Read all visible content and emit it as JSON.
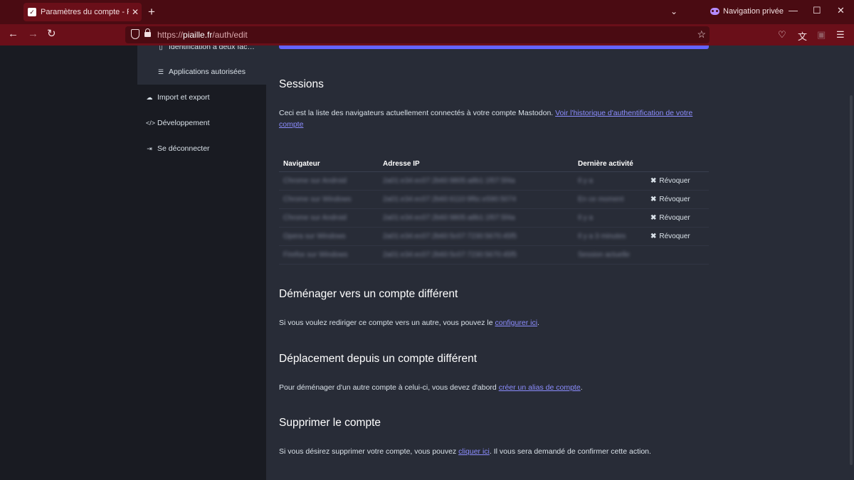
{
  "browser": {
    "tab_title": "Paramètres du compte - Piaille",
    "private_label": "Navigation privée",
    "url_prefix": "https://",
    "url_host": "piaille.fr",
    "url_path": "/auth/edit"
  },
  "sidebar": {
    "items": [
      {
        "label": "Identification à deux fac…",
        "icon": "mobile-icon"
      },
      {
        "label": "Applications autorisées",
        "icon": "list-icon"
      },
      {
        "label": "Import et export",
        "icon": "cloud-icon"
      },
      {
        "label": "Développement",
        "icon": "code-icon"
      },
      {
        "label": "Se déconnecter",
        "icon": "sign-out-icon"
      }
    ]
  },
  "sessions": {
    "title": "Sessions",
    "intro": "Ceci est la liste des navigateurs actuellement connectés à votre compte Mastodon. ",
    "intro_link": "Voir l'historique d'authentification de votre compte",
    "columns": [
      "Navigateur",
      "Adresse IP",
      "Dernière activité"
    ],
    "revoke_label": "Révoquer",
    "rows": [
      {
        "browser": "Chrome sur Android",
        "ip": "2a01:e34:ec07:2b60:9805:a8b1:1f07:5f4a",
        "activity": "Il y a",
        "revoke": true
      },
      {
        "browser": "Chrome sur Windows",
        "ip": "2a01:e34:ec07:2b60:6110:9f6c:e590:5074",
        "activity": "En ce moment",
        "revoke": true
      },
      {
        "browser": "Chrome sur Android",
        "ip": "2a01:e34:ec07:2b60:9805:a8b1:1f07:5f4a",
        "activity": "Il y a",
        "revoke": true
      },
      {
        "browser": "Opera sur Windows",
        "ip": "2a01:e34:ec07:2b60:5c07:7230:5670:45f5",
        "activity": "Il y a 3 minutes",
        "revoke": true
      },
      {
        "browser": "Firefox sur Windows",
        "ip": "2a01:e34:ec07:2b60:5c07:7230:5670:45f5",
        "activity": "Session actuelle",
        "revoke": false
      }
    ]
  },
  "move_to": {
    "title": "Déménager vers un compte différent",
    "text": "Si vous voulez rediriger ce compte vers un autre, vous pouvez le ",
    "link": "configurer ici",
    "after": "."
  },
  "move_from": {
    "title": "Déplacement depuis un compte différent",
    "text": "Pour déménager d'un autre compte à celui-ci, vous devez d'abord ",
    "link": "créer un alias de compte",
    "after": "."
  },
  "delete": {
    "title": "Supprimer le compte",
    "text": "Si vous désirez supprimer votre compte, vous pouvez ",
    "link": "cliquer ici",
    "after": ". Il vous sera demandé de confirmer cette action."
  }
}
